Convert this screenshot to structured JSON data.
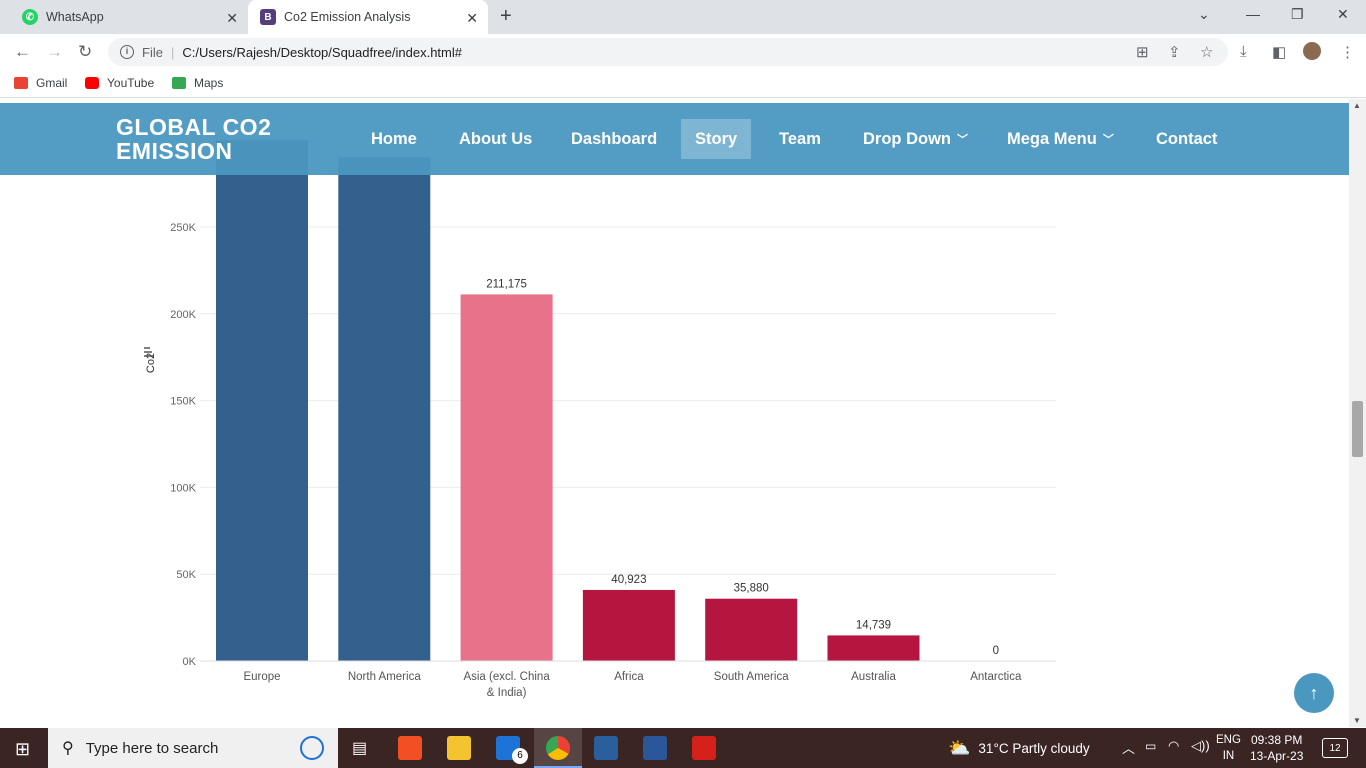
{
  "browser": {
    "tabs": [
      {
        "title": "WhatsApp",
        "favicon": "whatsapp-icon",
        "color": "#25d366"
      },
      {
        "title": "Co2 Emission Analysis",
        "favicon": "bootstrap-icon",
        "color": "#563d7c"
      }
    ],
    "url_scheme": "File",
    "url": "C:/Users/Rajesh/Desktop/Squadfree/index.html#",
    "bookmarks": [
      {
        "label": "Gmail",
        "icon": "gmail-icon",
        "color": "#ea4335"
      },
      {
        "label": "YouTube",
        "icon": "youtube-icon",
        "color": "#ff0000"
      },
      {
        "label": "Maps",
        "icon": "maps-icon",
        "color": "#34a853"
      }
    ]
  },
  "site": {
    "logo_line1": "GLOBAL CO2",
    "logo_line2": "EMISSION",
    "nav": [
      "Home",
      "About Us",
      "Dashboard",
      "Story",
      "Team",
      "Drop Down",
      "Mega Menu",
      "Contact"
    ],
    "active_nav": "Story",
    "header_color": "#4a97c0"
  },
  "chart_data": {
    "type": "bar",
    "ylabel": "Co2",
    "ylim": [
      0,
      250000
    ],
    "yticks": [
      "0K",
      "50K",
      "100K",
      "150K",
      "200K",
      "250K"
    ],
    "categories": [
      "Europe",
      "North America",
      "Asia (excl. China & India)",
      "Africa",
      "South America",
      "Australia",
      "Antarctica"
    ],
    "values": [
      300000,
      290000,
      211175,
      40923,
      35880,
      14739,
      0
    ],
    "value_labels": [
      "",
      "",
      "211,175",
      "40,923",
      "35,880",
      "14,739",
      "0"
    ],
    "colors": [
      "#33608c",
      "#33608c",
      "#e8728a",
      "#b5163f",
      "#b5163f",
      "#b5163f",
      "#b5163f"
    ]
  },
  "taskbar": {
    "search_placeholder": "Type here to search",
    "weather": "31°C  Partly cloudy",
    "lang_line1": "ENG",
    "lang_line2": "IN",
    "time": "09:38 PM",
    "date": "13-Apr-23",
    "notifications": "12",
    "mail_badge": "6"
  }
}
